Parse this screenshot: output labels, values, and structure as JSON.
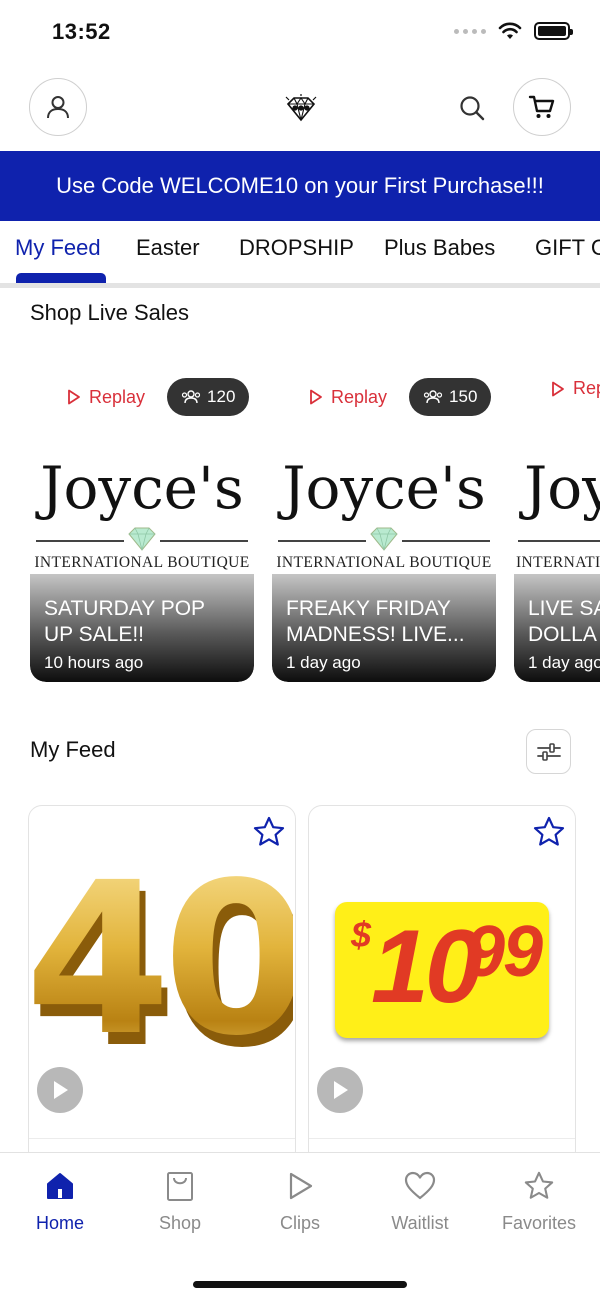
{
  "status_bar": {
    "time": "13:52"
  },
  "header": {
    "profile_icon": "person-icon",
    "logo_icon": "diamond-logo-icon",
    "search_icon": "search-icon",
    "cart_icon": "cart-icon"
  },
  "promo": {
    "text": "Use Code WELCOME10 on your First Purchase!!!",
    "color": "#0f22ad"
  },
  "tabs": [
    {
      "label": "My Feed",
      "active": true
    },
    {
      "label": "Easter"
    },
    {
      "label": "DROPSHIP"
    },
    {
      "label": "Plus Babes"
    },
    {
      "label": "GIFT C"
    }
  ],
  "live_sales": {
    "title": "Shop Live Sales",
    "items": [
      {
        "replay": "Replay",
        "viewers": "120",
        "brand": "Joyce's",
        "subtitle": "INTERNATIONAL BOUTIQUE",
        "title_line1": "SATURDAY POP",
        "title_line2": "UP SALE!!",
        "time": "10 hours ago"
      },
      {
        "replay": "Replay",
        "viewers": "150",
        "brand": "Joyce's",
        "subtitle": "INTERNATIONAL BOUTIQUE",
        "title_line1": "FREAKY FRIDAY",
        "title_line2": "MADNESS! LIVE...",
        "time": "1 day ago"
      },
      {
        "replay": "Rep",
        "brand": "Joy",
        "subtitle": "INTERNATI",
        "title_line1": "Live Sa",
        "title_line2": "DOLLA",
        "time": "1 day ago"
      }
    ]
  },
  "feed": {
    "title": "My Feed",
    "filter_icon": "sliders-icon",
    "products": [
      {
        "image_text": "40",
        "favorite_icon": "star-icon",
        "play_icon": "play-icon"
      },
      {
        "price_dollar": "$",
        "price_main": "10",
        "price_cents": "99",
        "favorite_icon": "star-icon",
        "play_icon": "play-icon"
      }
    ]
  },
  "bottom_nav": [
    {
      "label": "Home",
      "icon": "home-icon",
      "active": true
    },
    {
      "label": "Shop",
      "icon": "shopping-bag-icon"
    },
    {
      "label": "Clips",
      "icon": "play-icon"
    },
    {
      "label": "Waitlist",
      "icon": "heart-icon"
    },
    {
      "label": "Favorites",
      "icon": "star-icon"
    }
  ],
  "colors": {
    "accent": "#0f22ad",
    "replay": "#d9303a",
    "price": "#e13a24",
    "price_bg": "#ffef18"
  }
}
